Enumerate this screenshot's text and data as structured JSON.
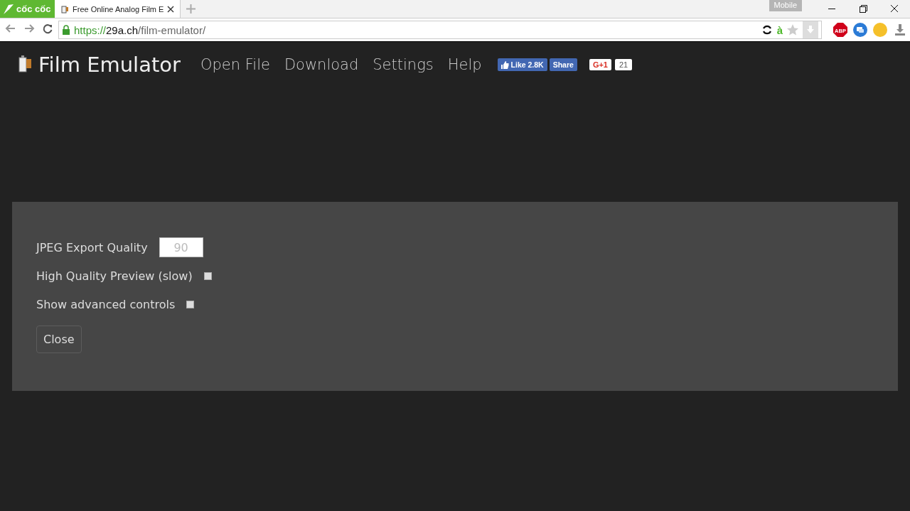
{
  "browser": {
    "brand": "cốc cốc",
    "tab_title": "Free Online Analog Film E",
    "mode_badge": "Mobile",
    "url_scheme": "https://",
    "url_host": "29a.ch",
    "url_path": "/film-emulator/",
    "lang_mark": "à",
    "extension_badge": "ABP"
  },
  "site": {
    "title": "Film Emulator",
    "nav": [
      "Open File",
      "Download",
      "Settings",
      "Help"
    ],
    "facebook": {
      "like": "Like 2.8K",
      "share": "Share"
    },
    "gplus": {
      "label": "G+1",
      "count": "21"
    }
  },
  "settings": {
    "fields": [
      {
        "kind": "number",
        "label": "JPEG Export Quality",
        "placeholder": "90"
      },
      {
        "kind": "checkbox",
        "label": "High Quality Preview (slow)",
        "checked": false
      },
      {
        "kind": "checkbox",
        "label": "Show advanced controls",
        "checked": false
      }
    ],
    "close": "Close"
  }
}
